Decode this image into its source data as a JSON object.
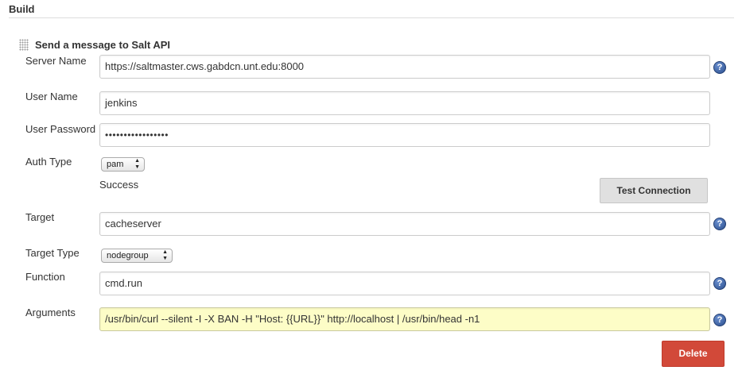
{
  "section": {
    "title": "Build"
  },
  "step": {
    "title": "Send a message to Salt API"
  },
  "fields": {
    "server_name": {
      "label": "Server Name",
      "value": "https://saltmaster.cws.gabdcn.unt.edu:8000"
    },
    "user_name": {
      "label": "User Name",
      "value": "jenkins"
    },
    "user_password": {
      "label": "User Password",
      "value": "•••••••••••••••••"
    },
    "auth_type": {
      "label": "Auth Type",
      "value": "pam"
    },
    "target": {
      "label": "Target",
      "value": "cacheserver"
    },
    "target_type": {
      "label": "Target Type",
      "value": "nodegroup"
    },
    "function": {
      "label": "Function",
      "value": "cmd.run"
    },
    "arguments": {
      "label": "Arguments",
      "value": "/usr/bin/curl --silent -I -X BAN -H \"Host: {{URL}}\" http://localhost | /usr/bin/head -n1"
    }
  },
  "connection": {
    "status": "Success",
    "test_label": "Test Connection"
  },
  "help_icon_glyph": "?",
  "select_arrows": {
    "up": "▲",
    "down": "▼"
  },
  "delete_label": "Delete",
  "colors": {
    "delete_button": "#d24939",
    "help_icon": "#2b4f8e",
    "highlight_input": "#fdfdc7"
  }
}
